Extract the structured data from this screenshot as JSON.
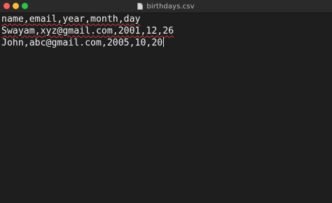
{
  "window": {
    "title": "birthdays.csv",
    "file_icon": "document-icon",
    "traffic_lights": {
      "close": "#ff5f57",
      "minimize": "#febc2e",
      "zoom": "#28c840"
    }
  },
  "editor": {
    "lines": [
      "name,email,year,month,day",
      "Swayam,xyz@gmail.com,2001,12,26",
      "John,abc@gmail.com,2005,10,20"
    ],
    "text_color": "#f2f2f2",
    "background": "#1e1e1e"
  }
}
